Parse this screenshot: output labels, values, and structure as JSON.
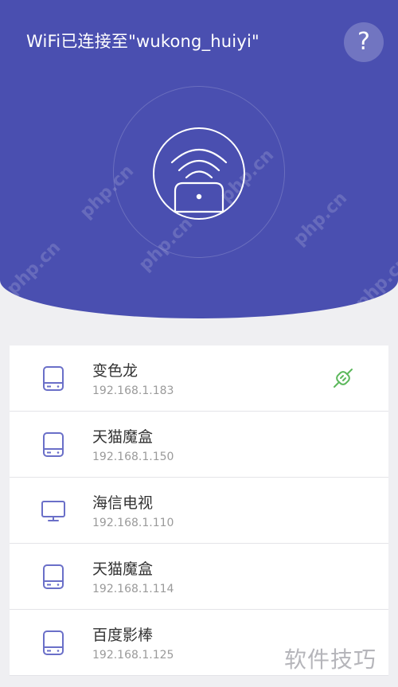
{
  "header": {
    "title": "WiFi已连接至\"wukong_huiyi\"",
    "help_label": "?",
    "watermark": "php.cn"
  },
  "devices": [
    {
      "name": "变色龙",
      "ip": "192.168.1.183",
      "icon": "box-icon",
      "connected": true
    },
    {
      "name": "天猫魔盒",
      "ip": "192.168.1.150",
      "icon": "box-icon",
      "connected": false
    },
    {
      "name": "海信电视",
      "ip": "192.168.1.110",
      "icon": "tv-icon",
      "connected": false
    },
    {
      "name": "天猫魔盒",
      "ip": "192.168.1.114",
      "icon": "box-icon",
      "connected": false
    },
    {
      "name": "百度影棒",
      "ip": "192.168.1.125",
      "icon": "box-icon",
      "connected": false
    }
  ],
  "footer": {
    "watermark": "软件技巧"
  },
  "colors": {
    "primary": "#4a4fb0",
    "icon": "#6a6fc8",
    "connected": "#5cb85c"
  }
}
